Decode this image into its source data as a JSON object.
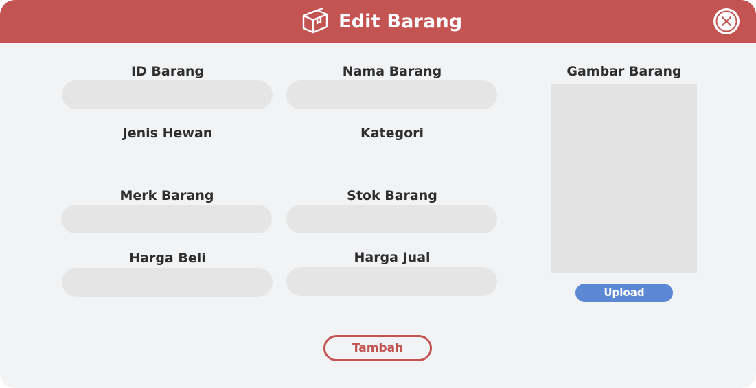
{
  "header": {
    "title": "Edit Barang",
    "icon": "box-icon",
    "close_icon": "close-icon",
    "background_color": "#c45452"
  },
  "form": {
    "fields": [
      {
        "label": "ID Barang",
        "value": ""
      },
      {
        "label": "Nama Barang",
        "value": ""
      },
      {
        "label": "Jenis Hewan"
      },
      {
        "label": "Kategori"
      },
      {
        "label": "Merk Barang",
        "value": ""
      },
      {
        "label": "Stok Barang",
        "value": ""
      },
      {
        "label": "Harga Beli",
        "value": ""
      },
      {
        "label": "Harga Jual",
        "value": ""
      }
    ]
  },
  "image_panel": {
    "label": "Gambar Barang",
    "upload_label": "Upload",
    "upload_color": "#5c87d3"
  },
  "actions": {
    "submit_label": "Tambah",
    "accent_color": "#c45452"
  }
}
